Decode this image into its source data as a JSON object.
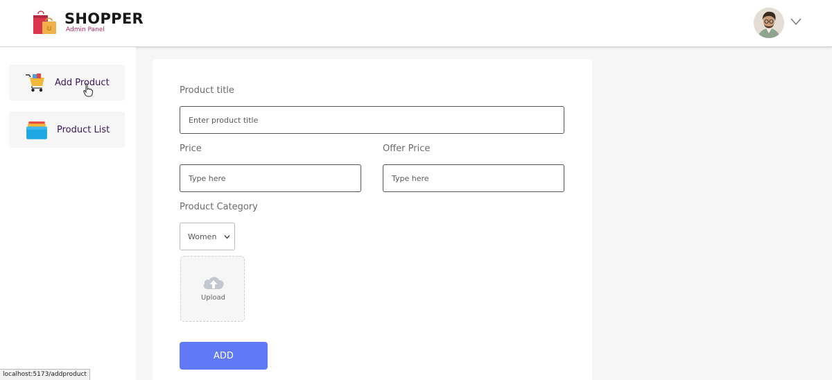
{
  "header": {
    "brand": "SHOPPER",
    "subtitle": "Admin Panel"
  },
  "sidebar": {
    "items": [
      {
        "label": "Add Product",
        "icon": "cart-icon"
      },
      {
        "label": "Product List",
        "icon": "folder-stack-icon"
      }
    ]
  },
  "form": {
    "title_label": "Product title",
    "title_placeholder": "Enter product title",
    "price_label": "Price",
    "price_placeholder": "Type here",
    "offer_label": "Offer Price",
    "offer_placeholder": "Type here",
    "category_label": "Product Category",
    "category_selected": "Women",
    "upload_label": "Upload",
    "add_button": "ADD"
  },
  "status": {
    "url": "localhost:5173/addproduct"
  },
  "colors": {
    "accent": "#6079f6",
    "sidebar_text": "#3c1659",
    "brand_sub": "#b0255f"
  }
}
